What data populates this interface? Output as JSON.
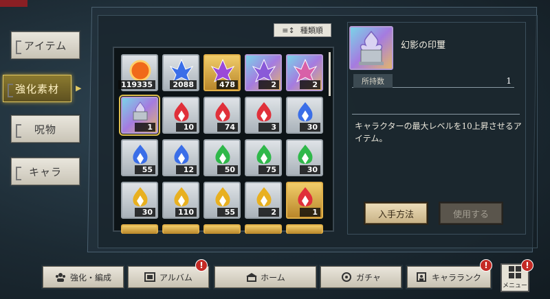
{
  "sidebar": {
    "tabs": [
      {
        "label": "アイテム",
        "active": false
      },
      {
        "label": "強化素材",
        "active": true
      },
      {
        "label": "呪物",
        "active": false
      },
      {
        "label": "キャラ",
        "active": false
      }
    ]
  },
  "sort_button": {
    "label": "種類順"
  },
  "grid": {
    "rows": [
      [
        {
          "qty": "119335",
          "icon": "orange-orb-icon",
          "frame": "silver"
        },
        {
          "qty": "2088",
          "icon": "blue-crystal-cluster-icon",
          "frame": "silver"
        },
        {
          "qty": "478",
          "icon": "purple-crystal-burst-icon",
          "frame": "gold"
        },
        {
          "qty": "2",
          "icon": "rainbow-crystal-burst-icon",
          "frame": "rainbow"
        },
        {
          "qty": "2",
          "icon": "pink-crystal-shard-icon",
          "frame": "rainbow"
        }
      ],
      [
        {
          "qty": "1",
          "icon": "phantom-seal-icon",
          "frame": "rainbow",
          "selected": true
        },
        {
          "qty": "10",
          "icon": "red-flame-heart-icon",
          "frame": "silver"
        },
        {
          "qty": "74",
          "icon": "red-flame-spade-icon",
          "frame": "silver"
        },
        {
          "qty": "3",
          "icon": "red-flame-dice-icon",
          "frame": "silver"
        },
        {
          "qty": "30",
          "icon": "blue-flame-heart-icon",
          "frame": "silver"
        }
      ],
      [
        {
          "qty": "55",
          "icon": "blue-flame-spade-icon",
          "frame": "silver"
        },
        {
          "qty": "12",
          "icon": "blue-flame-diamond-icon",
          "frame": "silver"
        },
        {
          "qty": "50",
          "icon": "green-flame-spade-icon",
          "frame": "silver"
        },
        {
          "qty": "75",
          "icon": "green-flame-diamond-icon",
          "frame": "silver"
        },
        {
          "qty": "30",
          "icon": "green-flame-heart-icon",
          "frame": "silver"
        }
      ],
      [
        {
          "qty": "30",
          "icon": "yellow-flame-spade-icon",
          "frame": "silver"
        },
        {
          "qty": "110",
          "icon": "yellow-flame-diamond-icon",
          "frame": "silver"
        },
        {
          "qty": "55",
          "icon": "yellow-flame-spade-icon",
          "frame": "silver"
        },
        {
          "qty": "2",
          "icon": "yellow-flame-dice-icon",
          "frame": "silver"
        },
        {
          "qty": "1",
          "icon": "red-flame-heart-icon",
          "frame": "gold"
        }
      ]
    ]
  },
  "detail": {
    "name": "幻影の印璽",
    "owned_label": "所持数",
    "owned_value": "1",
    "description": "キャラクターの最大レベルを10上昇させるアイテム。",
    "acquire_label": "入手方法",
    "use_label": "使用する"
  },
  "bottom_nav": [
    {
      "label": "強化・編成",
      "icon": "team-icon",
      "badge": false
    },
    {
      "label": "アルバム",
      "icon": "album-icon",
      "badge": true
    },
    {
      "label": "ホーム",
      "icon": "home-icon",
      "badge": false
    },
    {
      "label": "ガチャ",
      "icon": "gacha-icon",
      "badge": false
    },
    {
      "label": "キャラランク",
      "icon": "character-rank-icon",
      "badge": true
    }
  ],
  "menu": {
    "label": "メニュー",
    "badge": true
  },
  "badge_mark": "!",
  "colors": {
    "accent_gold": "#e0c865",
    "badge_red": "#c42a25",
    "active_tab": "#8b7a2f"
  }
}
